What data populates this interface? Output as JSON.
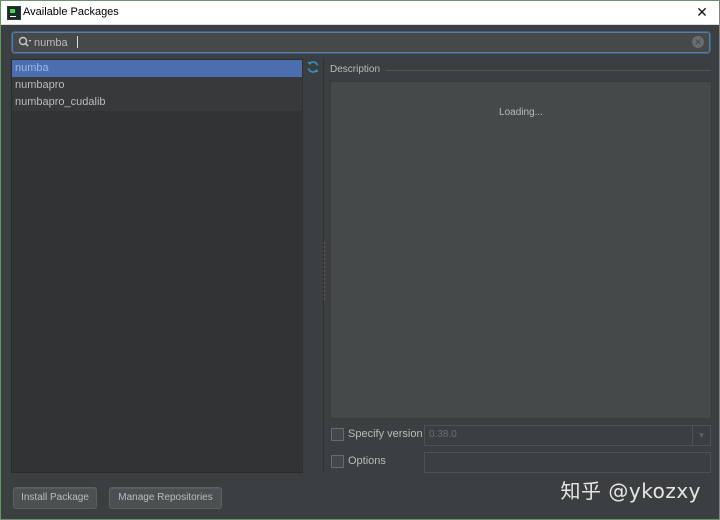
{
  "window": {
    "title": "Available Packages",
    "close_glyph": "✕"
  },
  "search": {
    "value": "numba",
    "placeholder": ""
  },
  "packages": [
    {
      "name": "numba",
      "selected": true
    },
    {
      "name": "numbapro",
      "selected": false
    },
    {
      "name": "numbapro_cudalib",
      "selected": false
    }
  ],
  "description": {
    "label": "Description",
    "loading_text": "Loading..."
  },
  "options": {
    "specify_version_label": "Specify version",
    "specify_version_checked": false,
    "version_value": "0.38.0",
    "options_label": "Options",
    "options_checked": false,
    "options_value": ""
  },
  "buttons": {
    "install_label": "Install Package",
    "manage_label": "Manage Repositories"
  },
  "watermark": "知乎 @ykozxy",
  "colors": {
    "selection": "#4b6eaf",
    "background": "#3c3f41",
    "accent_icon": "#3592c4"
  }
}
